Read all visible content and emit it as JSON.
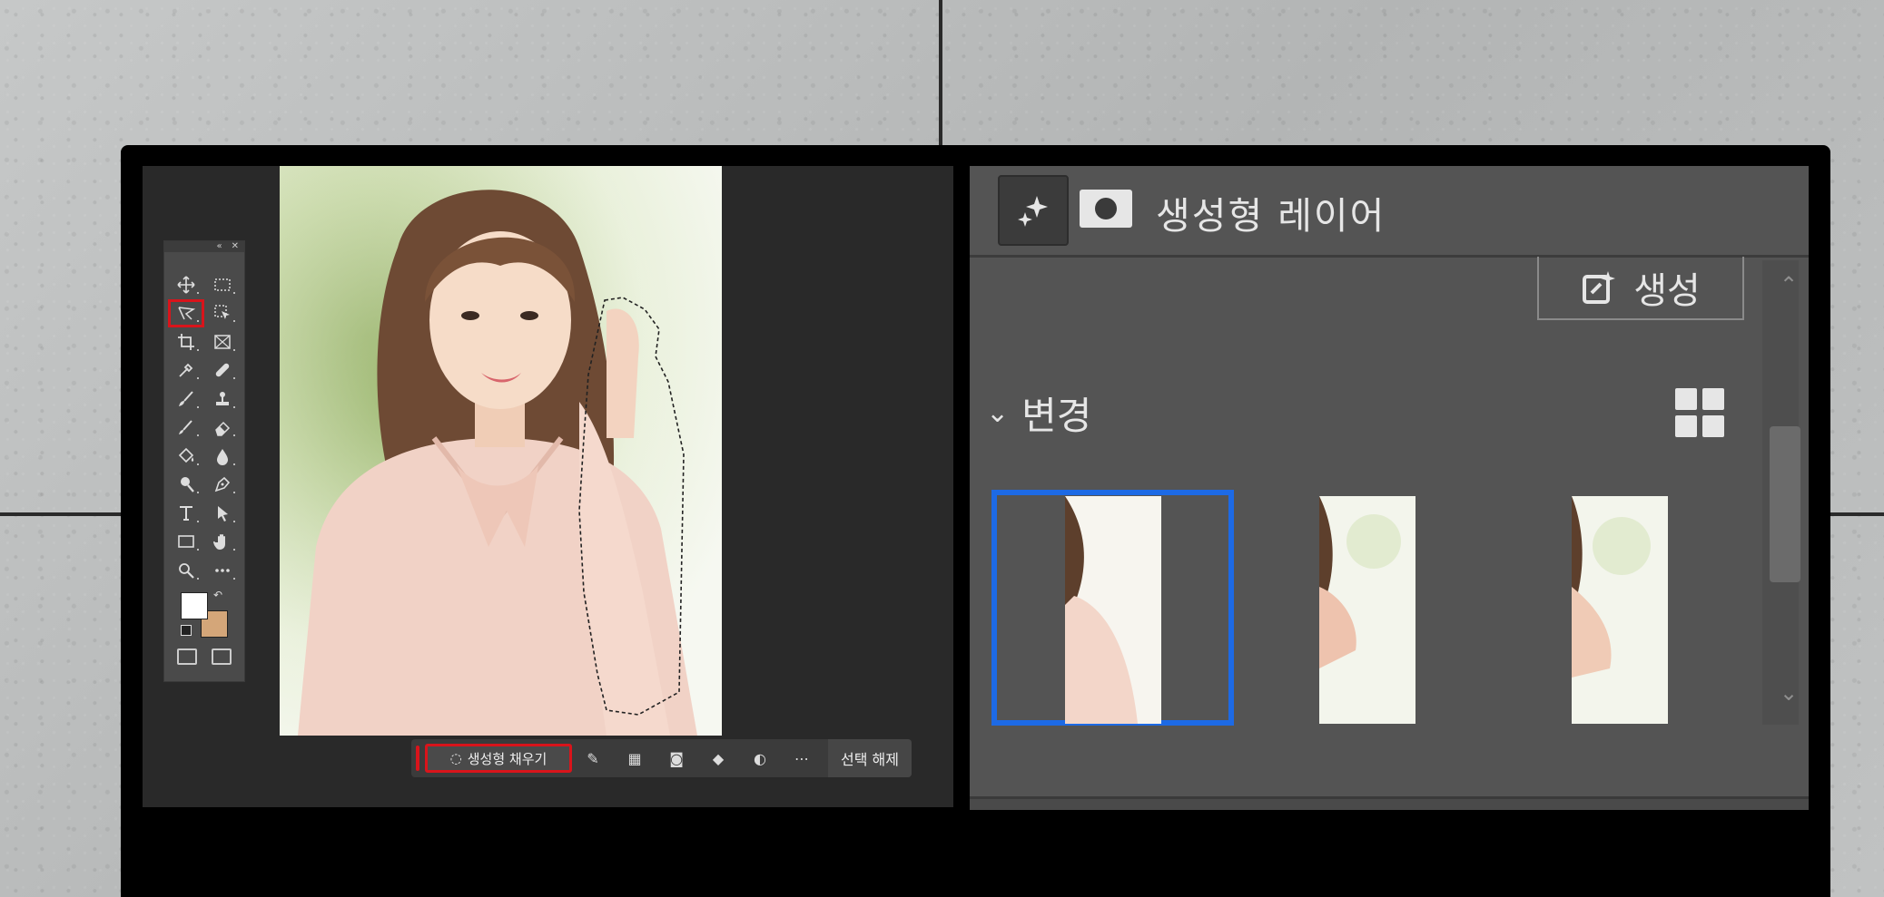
{
  "taskbar": {
    "generative_fill_label": "생성형 채우기",
    "deselect_label": "선택 해제"
  },
  "properties_panel": {
    "title": "생성형 레이어",
    "generate_button_label": "생성",
    "variations_heading": "변경",
    "variations_count": 3,
    "selected_variation": 1
  },
  "toolbar": {
    "selected_tool": "lasso-tool",
    "foreground_color": "#ffffff",
    "background_color": "#d4a679"
  },
  "colors": {
    "selection_highlight": "#d9141b",
    "variation_selected": "#1d6ae5"
  }
}
